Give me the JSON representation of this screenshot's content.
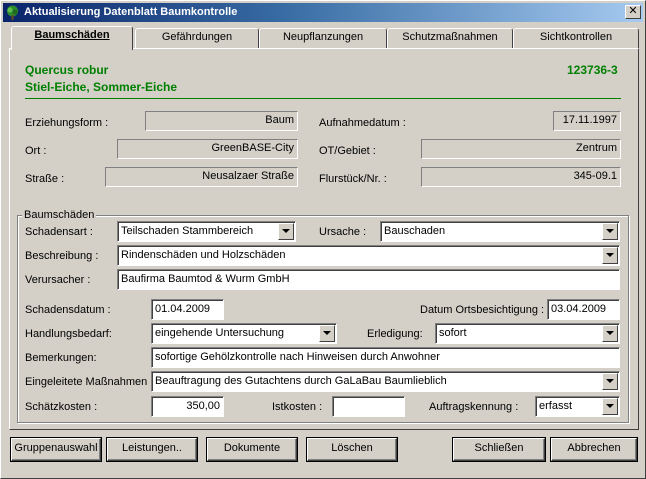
{
  "window": {
    "title": "Aktualisierung Datenblatt Baumkontrolle",
    "close": "✕"
  },
  "tabs": [
    "Baumschäden",
    "Gefährdungen",
    "Neupflanzungen",
    "Schutzmaßnahmen",
    "Sichtkontrollen"
  ],
  "tree": {
    "latin": "Quercus robur",
    "common": "Stiel-Eiche, Sommer-Eiche",
    "id": "123736-3"
  },
  "info": {
    "erziehungsform_label": "Erziehungsform :",
    "erziehungsform": "Baum",
    "aufnahmedatum_label": "Aufnahmedatum :",
    "aufnahmedatum": "17.11.1997",
    "ort_label": "Ort :",
    "ort": "GreenBASE-City",
    "gebiet_label": "OT/Gebiet :",
    "gebiet": "Zentrum",
    "strasse_label": "Straße :",
    "strasse": "Neusalzaer Straße",
    "flurstueck_label": "Flurstück/Nr. :",
    "flurstueck": "345-09.1"
  },
  "damage": {
    "group_label": "Baumschäden",
    "schadensart_label": "Schadensart :",
    "schadensart": "Teilschaden Stammbereich",
    "ursache_label": "Ursache :",
    "ursache": "Bauschaden",
    "beschreibung_label": "Beschreibung :",
    "beschreibung": "Rindenschäden und Holzschäden",
    "verursacher_label": "Verursacher :",
    "verursacher": "Baufirma Baumtod & Wurm GmbH",
    "schadensdatum_label": "Schadensdatum :",
    "schadensdatum": "01.04.2009",
    "ortsbesichtigung_label": "Datum Ortsbesichtigung :",
    "ortsbesichtigung": "03.04.2009",
    "handlungsbedarf_label": "Handlungsbedarf:",
    "handlungsbedarf": "eingehende Untersuchung",
    "erledigung_label": "Erledigung:",
    "erledigung": "sofort",
    "bemerkungen_label": "Bemerkungen:",
    "bemerkungen": "sofortige Gehölzkontrolle nach Hinweisen durch Anwohner",
    "massnahmen_label": "Eingeleitete Maßnahmen :",
    "massnahmen": "Beauftragung des Gutachtens durch GaLaBau Baumlieblich",
    "schaetzkosten_label": "Schätzkosten :",
    "schaetzkosten": "350,00",
    "istkosten_label": "Istkosten :",
    "istkosten": "",
    "auftragskennung_label": "Auftragskennung :",
    "auftragskennung": "erfasst"
  },
  "buttons": {
    "gruppenauswahl": "Gruppenauswahl",
    "leistungen": "Leistungen..",
    "dokumente": "Dokumente",
    "loeschen": "Löschen",
    "schliessen": "Schließen",
    "abbrechen": "Abbrechen"
  },
  "colors": {
    "title_gradient_start": "#0a246a",
    "title_gradient_end": "#a6caf0",
    "species": "#008000",
    "face": "#d4d0c8"
  }
}
